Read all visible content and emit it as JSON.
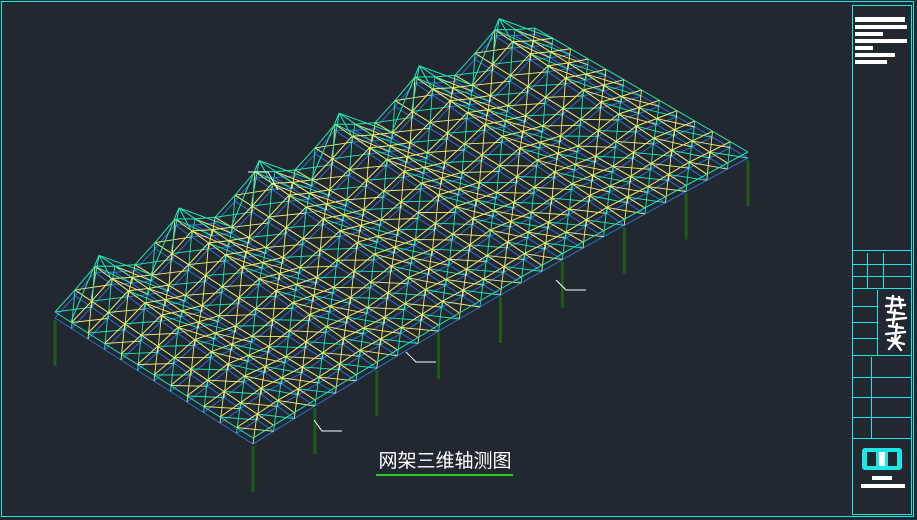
{
  "drawing": {
    "caption": "网架三维轴测图"
  },
  "colors": {
    "background": "#212830",
    "frame": "#1ee6e6",
    "members_cyan": "#1fe8b8",
    "members_yellow": "#f2ee72",
    "members_blue": "#2f6fd4",
    "columns": "#1f5a1a",
    "caption_underline": "#25d020",
    "leaders": "#ffffff"
  },
  "title_block": {
    "icons": [
      "company-logo-icon"
    ]
  }
}
